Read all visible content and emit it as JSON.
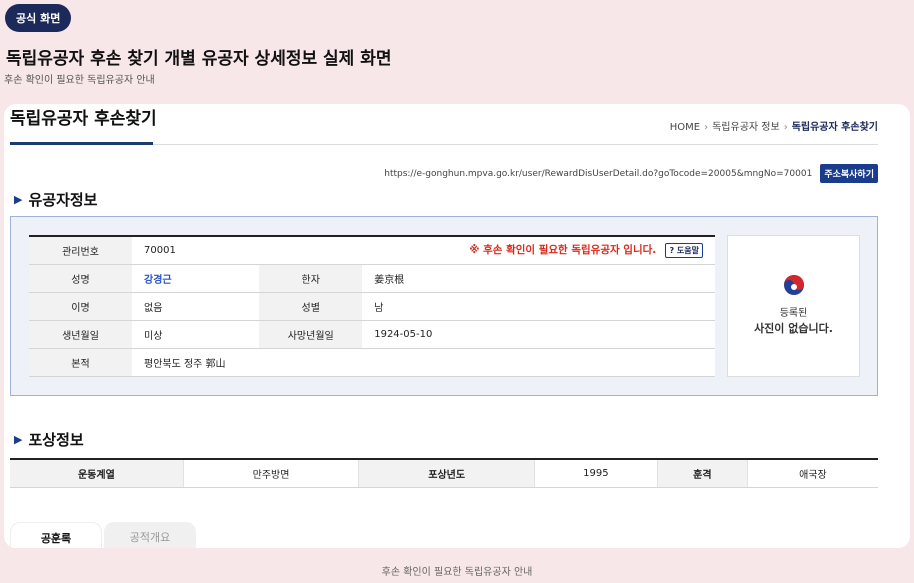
{
  "badge": "공식 화면",
  "page": {
    "title": "독립유공자 후손 찾기 개별 유공자 상세정보 실제 화면",
    "subtitle": "후손 확인이 필요한 독립유공자 안내"
  },
  "site": {
    "title": "독립유공자 후손찾기",
    "breadcrumb": [
      "HOME",
      "독립유공자 정보",
      "독립유공자 후손찾기"
    ],
    "breadcrumb_sep": "›",
    "url": "https://e-gonghun.mpva.go.kr/user/RewardDisUserDetail.do?goTocode=20005&mngNo=70001",
    "copy_button": "주소복사하기"
  },
  "sections": {
    "info_title": "유공자정보",
    "reward_title": "포상정보",
    "marker": "▶"
  },
  "info": {
    "labels": {
      "id": "관리번호",
      "name": "성명",
      "hanja": "한자",
      "alias": "이명",
      "gender": "성별",
      "birth": "생년월일",
      "death": "사망년월일",
      "origin": "본적"
    },
    "values": {
      "id": "70001",
      "name": "강경근",
      "hanja": "姜京根",
      "alias": "없음",
      "gender": "남",
      "birth": "미상",
      "death": "1924-05-10",
      "origin": "평안북도 정주 郭山"
    },
    "alert": "※ 후손 확인이 필요한 독립유공자 입니다.",
    "help_button": "도움말",
    "help_mark": "?",
    "photo_line1": "등록된",
    "photo_line2": "사진이 없습니다."
  },
  "reward": {
    "labels": {
      "movement": "운동계열",
      "year": "포상년도",
      "medal": "훈격"
    },
    "values": {
      "movement": "만주방면",
      "year": "1995",
      "medal": "애국장"
    }
  },
  "tabs": [
    "공훈록",
    "공적개요"
  ],
  "footer": "후손 확인이 필요한 독립유공자 안내",
  "colors": {
    "background": "#f7e7e9",
    "navy": "#1b2a5b",
    "alert_red": "#d92a1c",
    "link_blue": "#2a55c6"
  }
}
